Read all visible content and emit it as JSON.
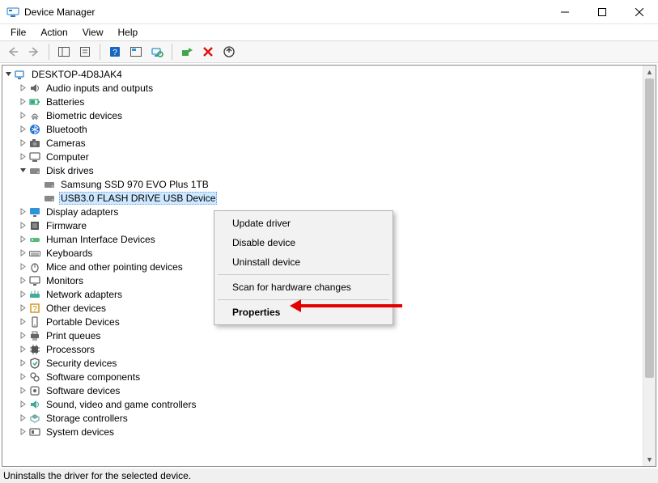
{
  "window": {
    "title": "Device Manager"
  },
  "menu": {
    "file": "File",
    "action": "Action",
    "view": "View",
    "help": "Help"
  },
  "root_name": "DESKTOP-4D8JAK4",
  "categories": [
    {
      "label": "Audio inputs and outputs",
      "icon": "audio"
    },
    {
      "label": "Batteries",
      "icon": "battery"
    },
    {
      "label": "Biometric devices",
      "icon": "fingerprint"
    },
    {
      "label": "Bluetooth",
      "icon": "bluetooth"
    },
    {
      "label": "Cameras",
      "icon": "camera"
    },
    {
      "label": "Computer",
      "icon": "computer"
    },
    {
      "label": "Disk drives",
      "icon": "disk",
      "expanded": true,
      "children": [
        {
          "label": "Samsung SSD 970 EVO Plus 1TB",
          "icon": "disk"
        },
        {
          "label": "USB3.0 FLASH DRIVE USB Device",
          "icon": "disk",
          "selected": true
        }
      ]
    },
    {
      "label": "Display adapters",
      "icon": "display"
    },
    {
      "label": "Firmware",
      "icon": "firmware"
    },
    {
      "label": "Human Interface Devices",
      "icon": "hid"
    },
    {
      "label": "Keyboards",
      "icon": "keyboard"
    },
    {
      "label": "Mice and other pointing devices",
      "icon": "mouse"
    },
    {
      "label": "Monitors",
      "icon": "monitor"
    },
    {
      "label": "Network adapters",
      "icon": "network"
    },
    {
      "label": "Other devices",
      "icon": "other"
    },
    {
      "label": "Portable Devices",
      "icon": "portable"
    },
    {
      "label": "Print queues",
      "icon": "printer"
    },
    {
      "label": "Processors",
      "icon": "cpu"
    },
    {
      "label": "Security devices",
      "icon": "security"
    },
    {
      "label": "Software components",
      "icon": "softcomp"
    },
    {
      "label": "Software devices",
      "icon": "softdev"
    },
    {
      "label": "Sound, video and game controllers",
      "icon": "sound"
    },
    {
      "label": "Storage controllers",
      "icon": "storage"
    },
    {
      "label": "System devices",
      "icon": "system"
    }
  ],
  "context_menu": {
    "update": "Update driver",
    "disable": "Disable device",
    "uninstall": "Uninstall device",
    "scan": "Scan for hardware changes",
    "properties": "Properties"
  },
  "status": "Uninstalls the driver for the selected device."
}
